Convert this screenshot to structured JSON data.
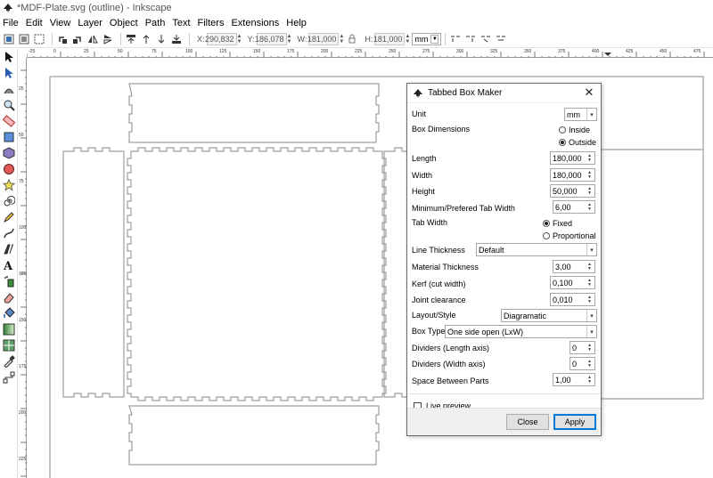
{
  "window": {
    "title": "*MDF-Plate.svg (outline) - Inkscape"
  },
  "menu": [
    "File",
    "Edit",
    "View",
    "Layer",
    "Object",
    "Path",
    "Text",
    "Filters",
    "Extensions",
    "Help"
  ],
  "toolbar": {
    "x_label": "X:",
    "x_value": "290,832",
    "y_label": "Y:",
    "y_value": "186,078",
    "w_label": "W:",
    "w_value": "181,000",
    "h_label": "H:",
    "h_value": "181,000",
    "unit": "mm"
  },
  "ruler": {
    "h_labels": [
      "-25",
      "0",
      "25",
      "50",
      "75",
      "100",
      "125",
      "150",
      "175",
      "200",
      "225",
      "250",
      "275",
      "300",
      "325",
      "350",
      "375",
      "400",
      "425",
      "450",
      "475"
    ],
    "v_labels": [
      "25",
      "50",
      "75",
      "100",
      "125",
      "150",
      "175",
      "200",
      "225"
    ]
  },
  "dialog": {
    "title": "Tabbed Box Maker",
    "unit_label": "Unit",
    "unit_value": "mm",
    "box_dim_label": "Box Dimensions",
    "inside_label": "Inside",
    "outside_label": "Outside",
    "length_label": "Length",
    "length_value": "180,000",
    "width_label": "Width",
    "width_value": "180,000",
    "height_label": "Height",
    "height_value": "50,000",
    "min_tab_label": "Minimum/Prefered Tab Width",
    "min_tab_value": "6,00",
    "tab_width_label": "Tab Width",
    "fixed_label": "Fixed",
    "proportional_label": "Proportional",
    "line_thickness_label": "Line Thickness",
    "line_thickness_value": "Default",
    "material_label": "Material Thickness",
    "material_value": "3,00",
    "kerf_label": "Kerf (cut width)",
    "kerf_value": "0,100",
    "joint_label": "Joint clearance",
    "joint_value": "0,010",
    "layout_label": "Layout/Style",
    "layout_value": "Diagramatic",
    "box_type_label": "Box Type",
    "box_type_value": "One side open (LxW)",
    "div_len_label": "Dividers (Length axis)",
    "div_len_value": "0",
    "div_wid_label": "Dividers (Width axis)",
    "div_wid_value": "0",
    "space_label": "Space Between Parts",
    "space_value": "1,00",
    "live_preview_label": "Live preview",
    "close_label": "Close",
    "apply_label": "Apply"
  }
}
